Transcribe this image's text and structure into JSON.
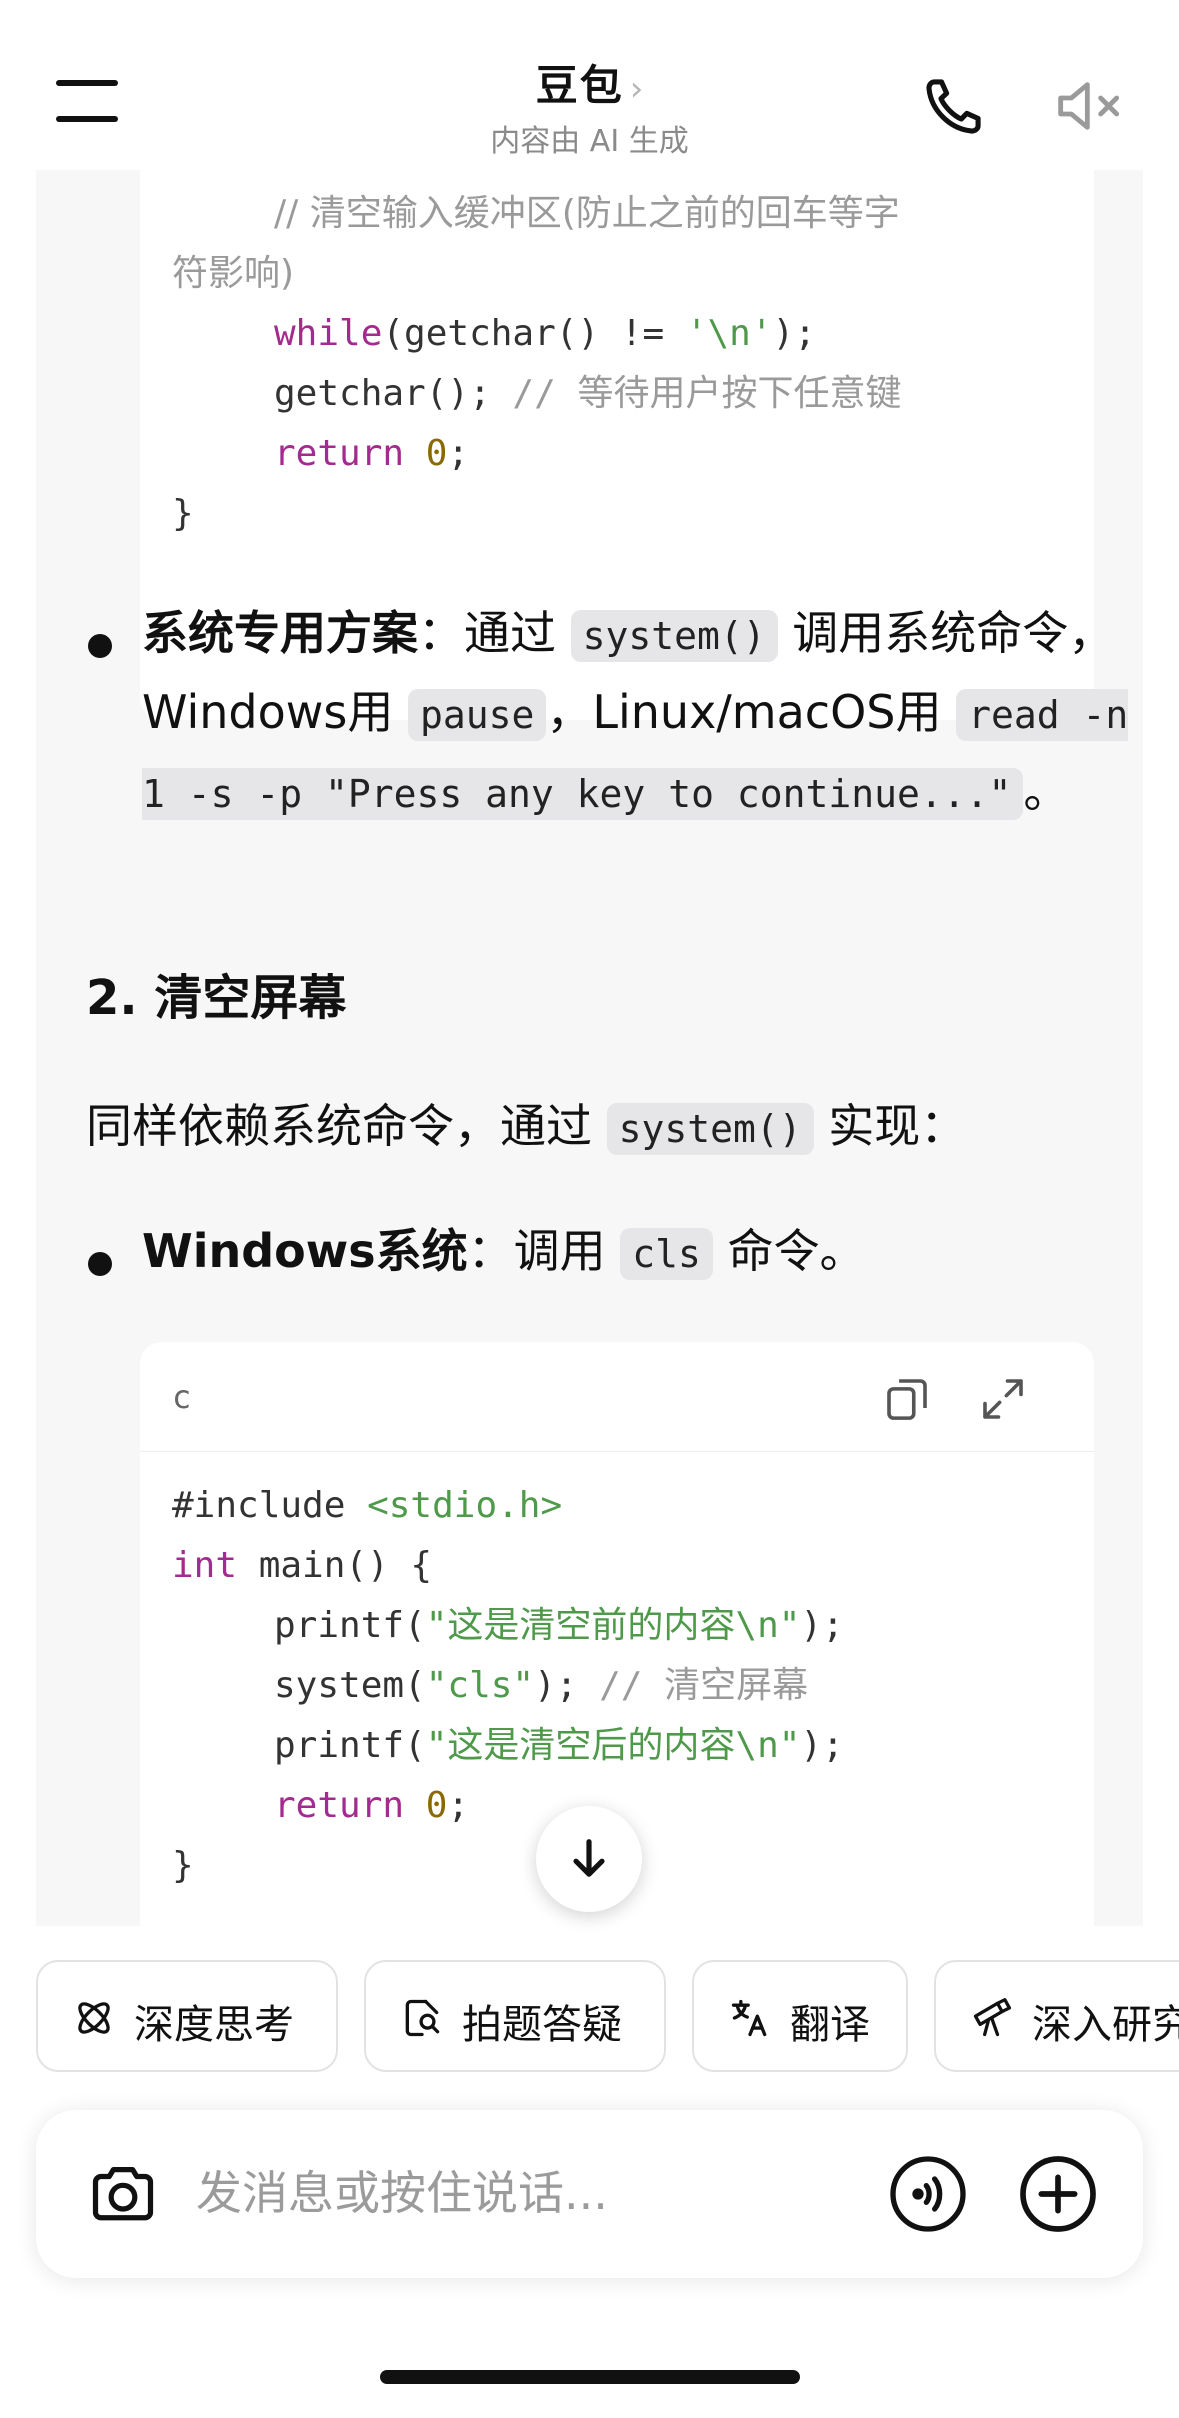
{
  "header": {
    "title": "豆包",
    "title_chevron": "›",
    "subtitle": "内容由 AI 生成"
  },
  "code_top": {
    "lines": [
      [
        {
          "t": "// 清空输入缓冲区(防止之前的回车等字",
          "c": "cn-cmt"
        }
      ],
      [
        {
          "t": "符影响)",
          "c": "cn-cmt"
        }
      ],
      [
        {
          "t": "while",
          "c": "kw"
        },
        {
          "t": "(getchar() != ",
          "c": ""
        },
        {
          "t": "'\\n'",
          "c": "str"
        },
        {
          "t": ");",
          "c": ""
        }
      ],
      [
        {
          "t": "getchar(); ",
          "c": ""
        },
        {
          "t": "// ",
          "c": "cmt"
        },
        {
          "t": "等待用户按下任意键",
          "c": "cn-cmt"
        }
      ],
      [
        {
          "t": "return",
          "c": "kw"
        },
        {
          "t": " ",
          "c": ""
        },
        {
          "t": "0",
          "c": "num"
        },
        {
          "t": ";",
          "c": ""
        }
      ],
      [
        {
          "t": "}",
          "c": ""
        }
      ]
    ],
    "indent": [
      true,
      false,
      true,
      true,
      true,
      false
    ]
  },
  "bullet_system": {
    "bold": "系统专用方案",
    "t1": "：通过 ",
    "code1": "system()",
    "t2": " 调用系统命令，Windows用 ",
    "code2": "pause",
    "t3": "，Linux/macOS用 ",
    "code3": "read -n 1 -s -p \"Press any key to continue...\"",
    "t4": "。"
  },
  "section_heading": "2. 清空屏幕",
  "para": {
    "t1": "同样依赖系统命令，通过 ",
    "code1": "system()",
    "t2": " 实现："
  },
  "bullet_windows": {
    "bold": "Windows系统",
    "t1": "：调用 ",
    "code1": "cls",
    "t2": " 命令。"
  },
  "code_bottom": {
    "lang": "c",
    "lines": [
      [
        {
          "t": "#include ",
          "c": ""
        },
        {
          "t": "<stdio.h>",
          "c": "str"
        }
      ],
      [
        {
          "t": "int",
          "c": "kw"
        },
        {
          "t": " main() {",
          "c": ""
        }
      ],
      [
        {
          "t": "printf(",
          "c": ""
        },
        {
          "t": "\"这是清空前的内容\\n\"",
          "c": "str"
        },
        {
          "t": ");",
          "c": ""
        }
      ],
      [
        {
          "t": "system(",
          "c": ""
        },
        {
          "t": "\"cls\"",
          "c": "str"
        },
        {
          "t": "); ",
          "c": ""
        },
        {
          "t": "// ",
          "c": "cmt"
        },
        {
          "t": "清空屏幕",
          "c": "cn-cmt"
        }
      ],
      [
        {
          "t": "printf(",
          "c": ""
        },
        {
          "t": "\"这是清空后的内容\\n\"",
          "c": "str"
        },
        {
          "t": ");",
          "c": ""
        }
      ],
      [
        {
          "t": "return",
          "c": "kw"
        },
        {
          "t": " ",
          "c": ""
        },
        {
          "t": "0",
          "c": "num"
        },
        {
          "t": ";",
          "c": ""
        }
      ],
      [
        {
          "t": "}",
          "c": ""
        }
      ]
    ],
    "indent": [
      false,
      false,
      true,
      true,
      true,
      true,
      false
    ]
  },
  "chips": [
    {
      "label": "深度思考",
      "icon": "atom-icon"
    },
    {
      "label": "拍题答疑",
      "icon": "photo-question-icon"
    },
    {
      "label": "翻译",
      "icon": "translate-icon"
    },
    {
      "label": "深入研究",
      "icon": "telescope-icon"
    }
  ],
  "input": {
    "placeholder": "发消息或按住说话..."
  }
}
